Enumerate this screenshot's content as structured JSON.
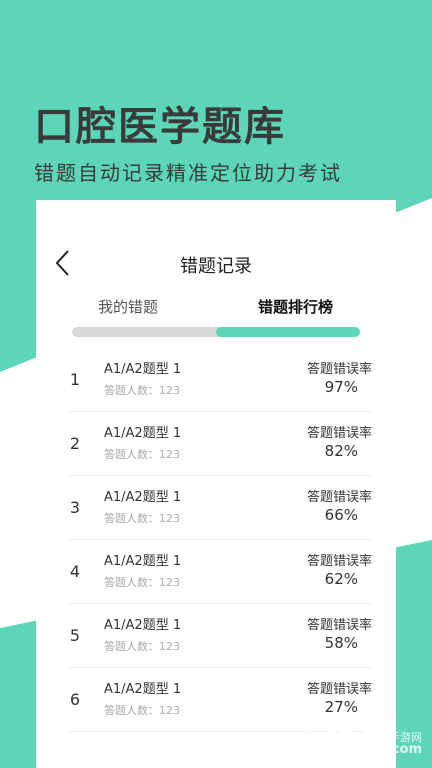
{
  "colors": {
    "accent": "#5cd6b6",
    "track": "#d8d8d8"
  },
  "hero": {
    "title": "口腔医学题库",
    "subtitle": "错题自动记录精准定位助力考试"
  },
  "screen": {
    "nav": {
      "title": "错题记录",
      "back_icon": "chevron-left-icon"
    },
    "tabs": [
      {
        "label": "我的错题",
        "active": false
      },
      {
        "label": "错题排行榜",
        "active": true
      }
    ],
    "tab_progress": 0.5,
    "ranking": [
      {
        "rank": "1",
        "name": "A1/A2题型 1",
        "count": "答题人数：123",
        "rate_label": "答题错误率",
        "rate": "97%"
      },
      {
        "rank": "2",
        "name": "A1/A2题型 1",
        "count": "答题人数：123",
        "rate_label": "答题错误率",
        "rate": "82%"
      },
      {
        "rank": "3",
        "name": "A1/A2题型 1",
        "count": "答题人数：123",
        "rate_label": "答题错误率",
        "rate": "66%"
      },
      {
        "rank": "4",
        "name": "A1/A2题型 1",
        "count": "答题人数：123",
        "rate_label": "答题错误率",
        "rate": "62%"
      },
      {
        "rank": "5",
        "name": "A1/A2题型 1",
        "count": "答题人数：123",
        "rate_label": "答题错误率",
        "rate": "58%"
      },
      {
        "rank": "6",
        "name": "A1/A2题型 1",
        "count": "答题人数：123",
        "rate_label": "答题错误率",
        "rate": "27%"
      }
    ]
  },
  "watermark": {
    "number": "2265",
    "site": "手游网",
    "domain": ".com"
  }
}
